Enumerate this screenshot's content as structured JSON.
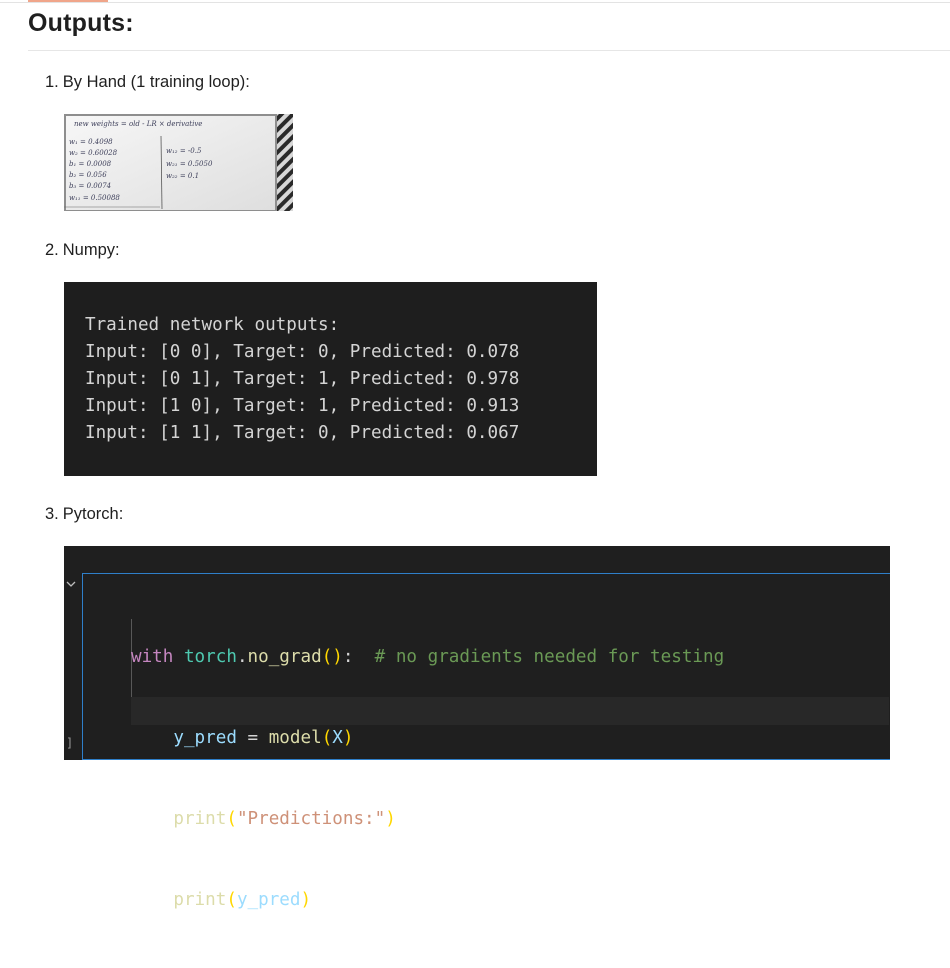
{
  "page": {
    "title": "Outputs:"
  },
  "items": [
    {
      "number": "1.",
      "label": "By Hand (1 training loop):"
    },
    {
      "number": "2.",
      "label": "Numpy:"
    },
    {
      "number": "3.",
      "label": "Pytorch:"
    }
  ],
  "handwritten_notes": {
    "header": "new weights = old - LR × derivative",
    "left_column": [
      "w₁ = 0.4098",
      "w₂ = 0.60028",
      "b₁ = 0.0008",
      "b₂ = 0.056",
      "b₃ = 0.0074",
      "w₁₁ = 0.50088"
    ],
    "right_column": [
      "w₁₂ = -0.5",
      "w₂₁ = 0.5050",
      "w₂₂ = 0.1"
    ]
  },
  "numpy_output": {
    "heading": "Trained network outputs:",
    "rows": [
      "Input: [0 0], Target: 0, Predicted: 0.078",
      "Input: [0 1], Target: 1, Predicted: 0.978",
      "Input: [1 0], Target: 1, Predicted: 0.913",
      "Input: [1 1], Target: 0, Predicted: 0.067"
    ]
  },
  "pytorch_code": {
    "line1": {
      "kw": "with",
      "mod": "torch",
      "dot": ".",
      "fn": "no_grad",
      "open": "(",
      "close": ")",
      "colon": ":",
      "comment": "# no gradients needed for testing"
    },
    "line2": {
      "var": "y_pred",
      "eq": " = ",
      "fn": "model",
      "open": "(",
      "arg": "X",
      "close": ")"
    },
    "line3": {
      "fn": "print",
      "open": "(",
      "str": "\"Predictions:\"",
      "close": ")"
    },
    "line4": {
      "fn": "print",
      "open": "(",
      "arg": "y_pred",
      "close": ")"
    },
    "cell_bracket": "]"
  },
  "colors": {
    "keyword": "#c586c0",
    "module": "#4ec9b0",
    "function": "#dcdcaa",
    "variable": "#9cdcfe",
    "string": "#ce9178",
    "comment": "#6a9955",
    "editor_border": "#2f7fc9"
  }
}
